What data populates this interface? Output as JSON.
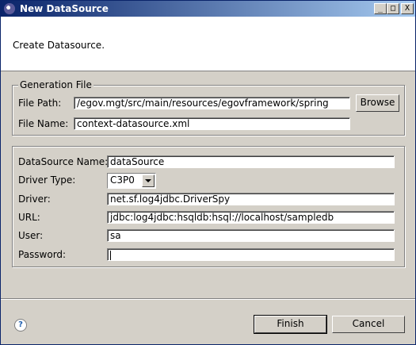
{
  "window": {
    "title": "New DataSource",
    "controls": {
      "minimize": "_",
      "maximize": "□",
      "close": "X"
    }
  },
  "header": {
    "message": "Create Datasource."
  },
  "generation_file": {
    "legend": "Generation File",
    "file_path_label": "File Path:",
    "file_path_value": "/egov.mgt/src/main/resources/egovframework/spring",
    "browse_label": "Browse",
    "file_name_label": "File Name:",
    "file_name_value": "context-datasource.xml"
  },
  "datasource": {
    "name_label": "DataSource Name:",
    "name_value": "dataSource",
    "driver_type_label": "Driver Type:",
    "driver_type_value": "C3P0",
    "driver_label": "Driver:",
    "driver_value": "net.sf.log4jdbc.DriverSpy",
    "url_label": "URL:",
    "url_value": "jdbc:log4jdbc:hsqldb:hsql://localhost/sampledb",
    "user_label": "User:",
    "user_value": "sa",
    "password_label": "Password:",
    "password_value": ""
  },
  "footer": {
    "help_glyph": "?",
    "finish_label": "Finish",
    "cancel_label": "Cancel"
  },
  "icons": [
    "app-icon",
    "help-icon",
    "chevron-down-icon"
  ]
}
